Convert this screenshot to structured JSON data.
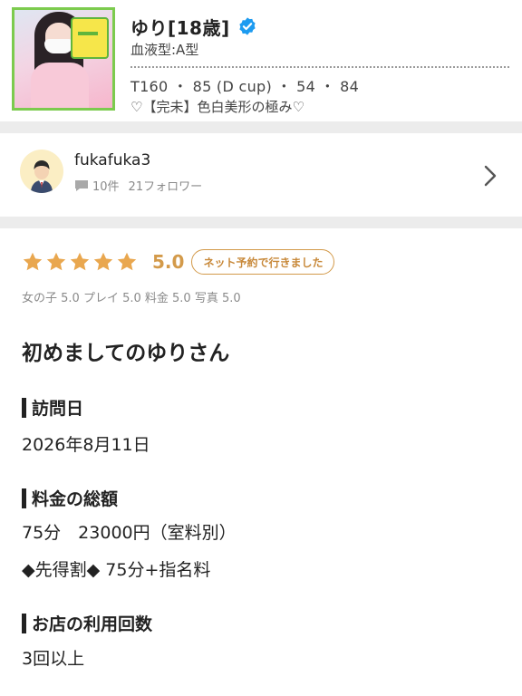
{
  "profile": {
    "name": "ゆり[18歳]",
    "verified_icon": "verified-check-icon",
    "blood_type": "血液型:A型",
    "sizes": "T160 ・ 85 (D cup) ・ 54 ・ 84",
    "catchphrase": "♡【完未】色白美形の極み♡"
  },
  "reviewer": {
    "username": "fukafuka3",
    "review_count": "10件",
    "followers": "21フォロワー",
    "avatar_icon": "user-avatar-icon",
    "chat_icon": "comment-icon",
    "chevron_icon": "chevron-right-icon"
  },
  "review": {
    "stars": 5,
    "score": "5.0",
    "booking_badge": "ネット予約で行きました",
    "subscores": "女の子 5.0 プレイ 5.0 料金 5.0 写真 5.0",
    "title": "初めましてのゆりさん",
    "sections": [
      {
        "heading": "訪問日",
        "lines": [
          "2026年8月11日"
        ]
      },
      {
        "heading": "料金の総額",
        "lines": [
          "75分　23000円（室料別）",
          "◆先得割◆ 75分+指名料"
        ]
      },
      {
        "heading": "お店の利用回数",
        "lines": [
          "3回以上"
        ]
      }
    ]
  },
  "colors": {
    "accent": "#e9a74f",
    "verified": "#1d9bf0",
    "thumb_border": "#7ccb4e"
  }
}
